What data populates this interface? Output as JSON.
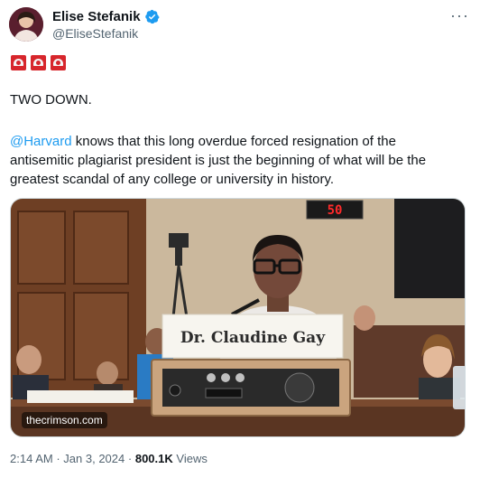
{
  "author": {
    "display_name": "Elise Stefanik",
    "handle": "@EliseStefanik",
    "verified": true
  },
  "more_options": "···",
  "tweet": {
    "sirens": [
      "police-car-light-emoji",
      "police-car-light-emoji",
      "police-car-light-emoji"
    ],
    "line1": "TWO DOWN.",
    "mention": "@Harvard",
    "line2_rest": " knows that this long overdue forced resignation of the",
    "line3": "antisemitic plagiarist president is just the beginning of what will be the",
    "line4": "greatest scandal of any college or university in history."
  },
  "media": {
    "nameplate": "Dr. Claudine Gay",
    "timer": "50",
    "watermark": "thecrimson.com"
  },
  "meta": {
    "time": "2:14 AM",
    "separator": "·",
    "date": "Jan 3, 2024",
    "views_count": "800.1K",
    "views_label": "Views"
  },
  "colors": {
    "link": "#1d9bf0",
    "secondary_text": "#536471",
    "verified": "#1d9bf0",
    "siren_red": "#d7262c"
  }
}
